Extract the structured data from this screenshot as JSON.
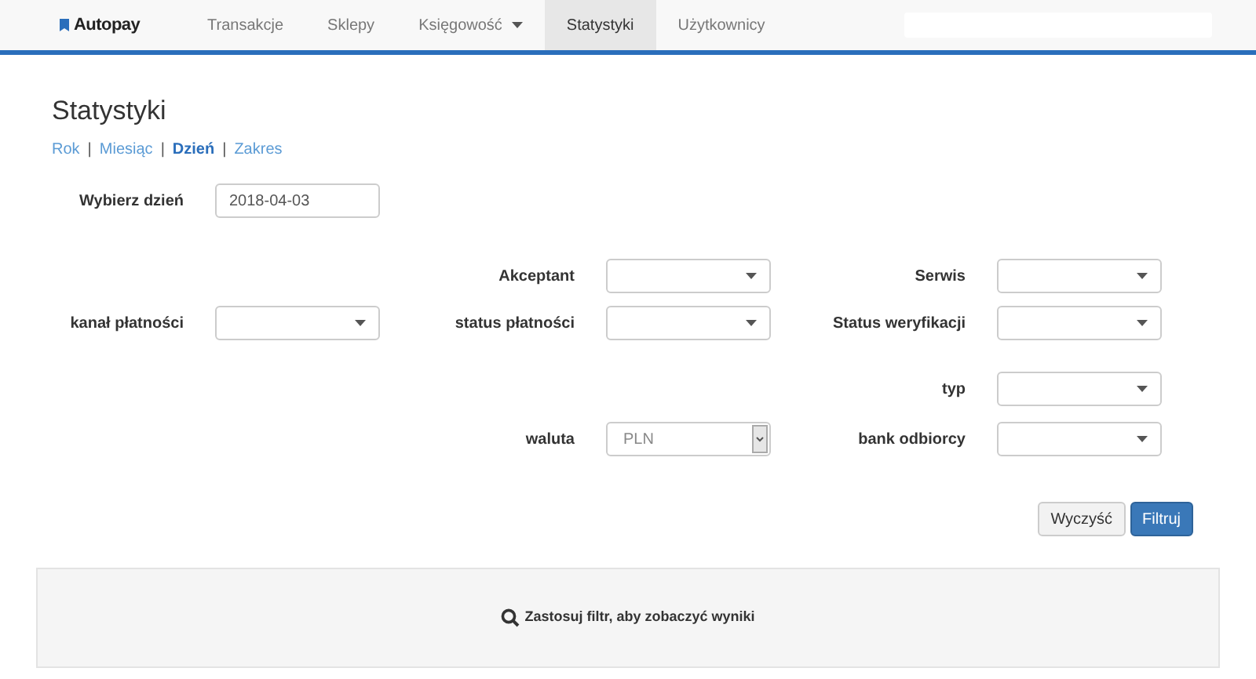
{
  "brand": "Autopay",
  "nav": [
    {
      "label": "Transakcje",
      "selected": false,
      "has_menu": false
    },
    {
      "label": "Sklepy",
      "selected": false,
      "has_menu": false
    },
    {
      "label": "Księgowość",
      "selected": false,
      "has_menu": true
    },
    {
      "label": "Statystyki",
      "selected": true,
      "has_menu": false
    },
    {
      "label": "Użytkownicy",
      "selected": false,
      "has_menu": false
    }
  ],
  "title": "Statystyki",
  "periods": [
    {
      "label": "Rok",
      "selected": false
    },
    {
      "label": "Miesiąc",
      "selected": false
    },
    {
      "label": "Dzień",
      "selected": true
    },
    {
      "label": "Zakres",
      "selected": false
    }
  ],
  "separator": "|",
  "filter_rows": [
    {
      "left": {
        "label": "Wybierz dzień",
        "kind": "date",
        "value": "2018-04-03"
      }
    },
    {
      "middle": {
        "label": "Akceptant",
        "kind": "select"
      },
      "right": {
        "label": "Serwis",
        "kind": "select"
      }
    },
    {
      "left": {
        "label": "kanał płatności",
        "kind": "select"
      },
      "middle": {
        "label": "status płatności",
        "kind": "select"
      },
      "right": {
        "label": "Status weryfikacji",
        "kind": "select"
      }
    },
    {
      "right": {
        "label": "typ",
        "kind": "select"
      }
    },
    {
      "middle": {
        "label": "waluta",
        "kind": "native",
        "value": "PLN"
      },
      "right": {
        "label": "bank odbiorcy",
        "kind": "select"
      }
    }
  ],
  "buttons": [
    {
      "label": "Wyczyść",
      "kind": "default"
    },
    {
      "label": "Filtruj",
      "kind": "primary"
    }
  ],
  "results_message": "Zastosuj filtr, aby zobaczyć wyniki"
}
